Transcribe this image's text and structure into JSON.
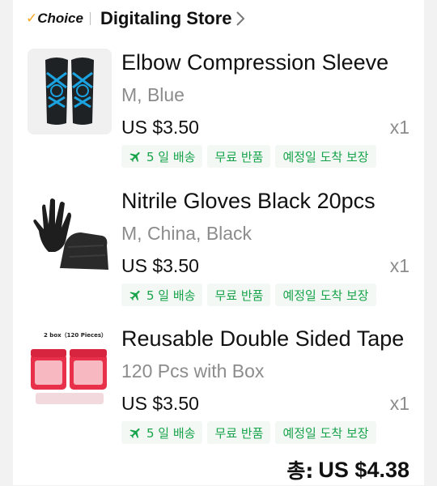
{
  "store": {
    "badge_check": "✓",
    "badge_label": "Choice",
    "name": "Digitaling Store"
  },
  "items": [
    {
      "title": "Elbow Compression Sleeve",
      "variant": "M, Blue",
      "price": "US $3.50",
      "qty": "x1",
      "tags": [
        "5 일 배송",
        "무료 반품",
        "예정일 도착 보장"
      ]
    },
    {
      "title": "Nitrile Gloves Black 20pcs",
      "variant": "M, China, Black",
      "price": "US $3.50",
      "qty": "x1",
      "tags": [
        "5 일 배송",
        "무료 반품",
        "예정일 도착 보장"
      ]
    },
    {
      "title": "Reusable Double Sided Tape",
      "variant": "120 Pcs with Box",
      "price": "US $3.50",
      "qty": "x1",
      "tags": [
        "5 일 배송",
        "무료 반품",
        "예정일 도착 보장"
      ],
      "image_caption": "2 box（120 Pieces）"
    }
  ],
  "summary": {
    "total_prefix": "총:",
    "total_amount": "US $4.38"
  },
  "colors": {
    "tag_green": "#16a34a",
    "choice_check": "#f5a623",
    "muted_text": "#8c8c8c"
  }
}
